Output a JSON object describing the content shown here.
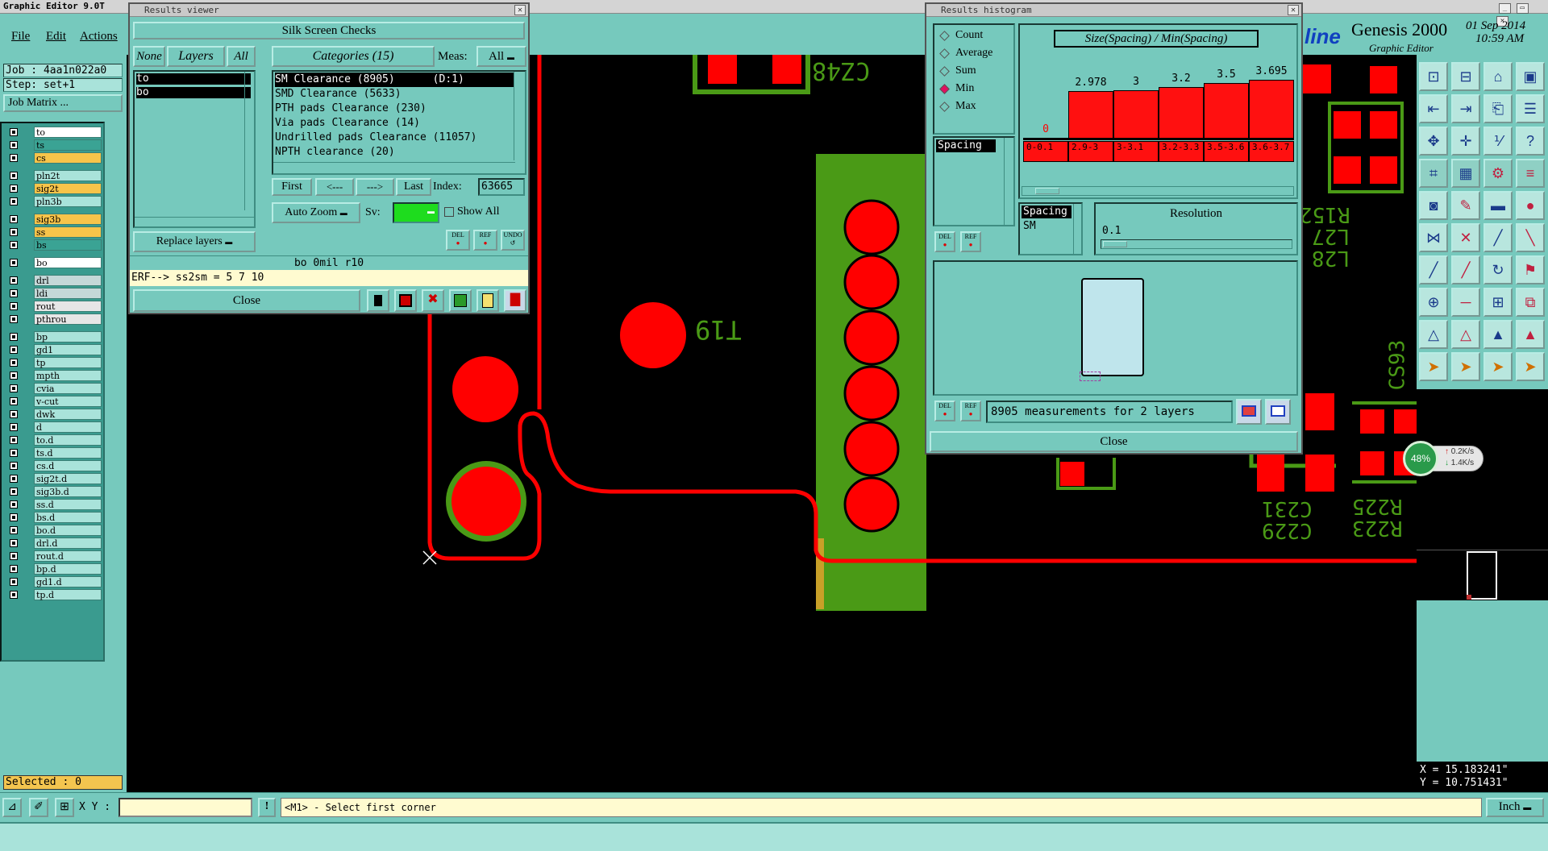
{
  "app": {
    "title": "Graphic Editor 9.0T"
  },
  "menu": {
    "file": "File",
    "edit": "Edit",
    "actions": "Actions"
  },
  "branding": {
    "logo_fragment": "line",
    "product": "Genesis 2000",
    "subtitle": "Graphic Editor",
    "date": "01 Sep 2014",
    "time": "10:59 AM"
  },
  "job": {
    "job": "Job : 4aa1n022a0",
    "step": "Step: set+1",
    "matrix_button": "Job Matrix ..."
  },
  "layers": [
    {
      "name": "to",
      "color": "#ffffff"
    },
    {
      "name": "ts",
      "color": "#3aa394"
    },
    {
      "name": "cs",
      "color": "#f7c44a"
    },
    {
      "name": "pln2t",
      "color": "#a9e3da"
    },
    {
      "name": "sig2t",
      "color": "#f7c44a"
    },
    {
      "name": "pln3b",
      "color": "#a9e3da"
    },
    {
      "name": "sig3b",
      "color": "#f7c44a"
    },
    {
      "name": "ss",
      "color": "#f7c44a"
    },
    {
      "name": "bs",
      "color": "#3aa394"
    },
    {
      "name": "bo",
      "color": "#ffffff"
    },
    {
      "name": "drl",
      "color": "#c4d8d8"
    },
    {
      "name": "ldi",
      "color": "#c4d8d8"
    },
    {
      "name": "rout",
      "color": "#e6e6e6"
    },
    {
      "name": "pthrou",
      "color": "#e6e6e6"
    },
    {
      "name": "bp",
      "color": "#a9e3da"
    },
    {
      "name": "gd1",
      "color": "#a9e3da"
    },
    {
      "name": "tp",
      "color": "#a9e3da"
    },
    {
      "name": "mpth",
      "color": "#a9e3da"
    },
    {
      "name": "cvia",
      "color": "#a9e3da"
    },
    {
      "name": "v-cut",
      "color": "#a9e3da"
    },
    {
      "name": "dwk",
      "color": "#a9e3da"
    },
    {
      "name": "d",
      "color": "#a9e3da"
    },
    {
      "name": "to.d",
      "color": "#a9e3da"
    },
    {
      "name": "ts.d",
      "color": "#a9e3da"
    },
    {
      "name": "cs.d",
      "color": "#a9e3da"
    },
    {
      "name": "sig2t.d",
      "color": "#a9e3da"
    },
    {
      "name": "sig3b.d",
      "color": "#a9e3da"
    },
    {
      "name": "ss.d",
      "color": "#a9e3da"
    },
    {
      "name": "bs.d",
      "color": "#a9e3da"
    },
    {
      "name": "bo.d",
      "color": "#a9e3da"
    },
    {
      "name": "drl.d",
      "color": "#a9e3da"
    },
    {
      "name": "rout.d",
      "color": "#a9e3da"
    },
    {
      "name": "bp.d",
      "color": "#a9e3da"
    },
    {
      "name": "gd1.d",
      "color": "#a9e3da"
    },
    {
      "name": "tp.d",
      "color": "#a9e3da"
    }
  ],
  "status": {
    "selected": "Selected : 0",
    "xy_label": "X Y :",
    "xy_value": "",
    "prompt": "<M1> - Select first corner",
    "units": "Inch",
    "coord_x": "X = 15.183241\"",
    "coord_y": "Y = 10.751431\""
  },
  "results_viewer": {
    "title": "Results viewer",
    "heading": "Silk Screen Checks",
    "none": "None",
    "layers": "Layers",
    "all": "All",
    "categories": "Categories (15)",
    "meas": "Meas:",
    "meas_value": "All",
    "layer_list": [
      "to",
      "bo"
    ],
    "category_list": [
      "SM Clearance (8905)      (D:1)",
      "SMD Clearance (5633)",
      "PTH pads Clearance (230)",
      "Via pads Clearance (14)",
      "Undrilled pads Clearance (11057)",
      "NPTH clearance (20)"
    ],
    "first": "First",
    "prev": "<---",
    "next": "--->",
    "last": "Last",
    "index_label": "Index:",
    "index_value": "63665",
    "auto_zoom": "Auto Zoom",
    "sv": "Sv:",
    "show_all": "Show All",
    "replace_layers": "Replace layers",
    "del": "DEL",
    "ref": "REF",
    "undo": "UNDO",
    "info": "bo  0mil  r10",
    "erf": "ERF--> ss2sm = 5 7 10",
    "close": "Close"
  },
  "histogram": {
    "title": "Results histogram",
    "options": [
      "Count",
      "Average",
      "Sum",
      "Min",
      "Max"
    ],
    "selected_option": "Min",
    "chart_title": "Size(Spacing) / Min(Spacing)",
    "list_item": "Spacing",
    "spacing_label": "Spacing",
    "sm_label": "SM",
    "resolution_label": "Resolution",
    "resolution_value": "0.1",
    "del": "DEL",
    "ref": "REF",
    "measurements": "8905 measurements for 2 layers",
    "close": "Close"
  },
  "chart_data": {
    "type": "bar",
    "title": "Size(Spacing) / Min(Spacing)",
    "categories": [
      "0-0.1",
      "2.9-3",
      "3-3.1",
      "3.2-3.3",
      "3.5-3.6",
      "3.6-3.7"
    ],
    "value_labels": [
      "0",
      "2.978",
      "3",
      "3.2",
      "3.5",
      "3.695"
    ],
    "values": [
      0,
      2.978,
      3,
      3.2,
      3.5,
      3.695
    ],
    "first_label_color": "#ff0000"
  },
  "pcb": {
    "labels": [
      "CZ48",
      "T19",
      "R152",
      "L27",
      "L28",
      "CS93",
      "R225",
      "R223",
      "C231",
      "C229"
    ],
    "colors": {
      "pad": "#ff0000",
      "silk": "#4a9a16",
      "trace": "#ff0000",
      "background": "#000000"
    }
  },
  "net_widget": {
    "percent": "48%",
    "up": "0.2K/s",
    "down": "1.4K/s"
  }
}
